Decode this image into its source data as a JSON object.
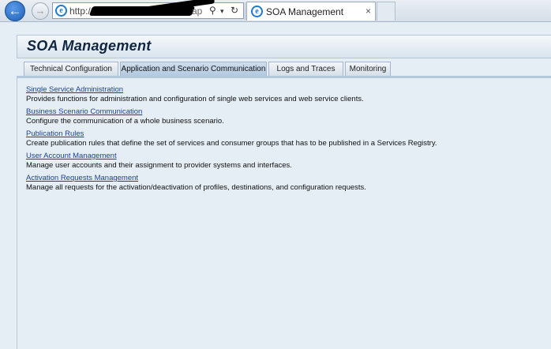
{
  "browser": {
    "back_icon": "arrow-left-icon",
    "forward_icon": "arrow-right-icon",
    "address_prefix": "http://",
    "address_suffix": "ap",
    "search_glyph": "⚲",
    "dropdown_glyph": "▾",
    "refresh_glyph": "↻",
    "tab_title": "SOA Management",
    "tab_close": "×"
  },
  "page": {
    "title": "SOA Management",
    "tabs": [
      {
        "label": "Technical Configuration",
        "active": false
      },
      {
        "label": "Application and Scenario Communication",
        "active": true
      },
      {
        "label": "Logs and Traces",
        "active": false
      },
      {
        "label": "Monitoring",
        "active": false
      }
    ],
    "items": [
      {
        "link": "Single Service Administration",
        "desc": "Provides functions for administration and configuration of single web services and web service clients."
      },
      {
        "link": "Business Scenario Communication",
        "desc": "Configure the communication of a whole business scenario."
      },
      {
        "link": "Publication Rules",
        "desc": "Create publication rules that define the set of services and consumer groups that has to be published in a Services Registry."
      },
      {
        "link": "User Account Management",
        "desc": "Manage user accounts and their assignment to provider systems and interfaces."
      },
      {
        "link": "Activation Requests Management",
        "desc": "Manage all requests for the activation/deactivation of profiles, destinations, and configuration requests."
      }
    ]
  }
}
